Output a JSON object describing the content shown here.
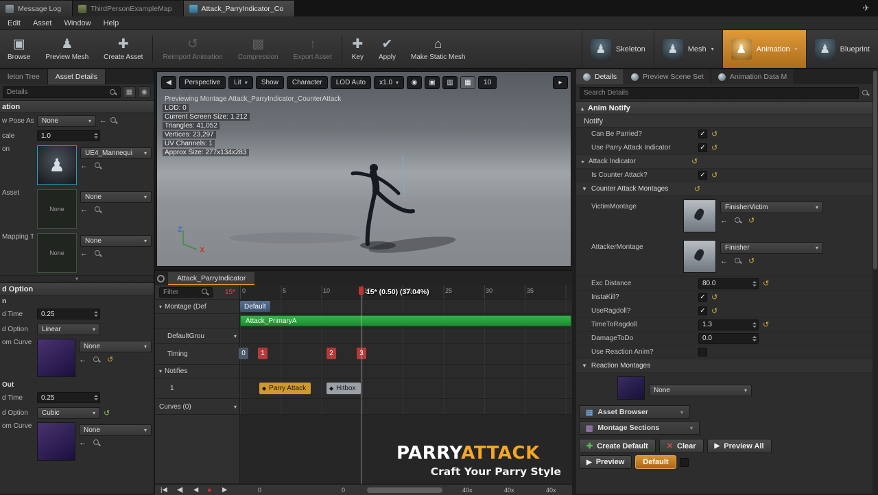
{
  "icons": {
    "dropdown": "▾",
    "caret_down": "▼",
    "caret_up": "▲",
    "tri_up": "▴",
    "tri_right": "▸",
    "back": "◀",
    "check": "✓",
    "reset": "↺",
    "pick": "←",
    "play": "▶",
    "record": "●",
    "close": "✕",
    "plus": "✚",
    "apply": "✔",
    "reimport": "↺",
    "export": "↑",
    "home": "⌂",
    "box": "▣",
    "figure": "♟",
    "grid": "▦",
    "grid2": "▥",
    "grid3": "▩",
    "lens": "◉",
    "list": "▤",
    "send": "✈",
    "skip_start": "|◀",
    "step_back": "◀|",
    "diamond": "◆",
    "eye": "◉",
    "dots": "▾"
  },
  "titlebar": {
    "tabs": [
      {
        "label": "Message Log"
      },
      {
        "label": "ThirdPersonExampleMap"
      },
      {
        "label": "Attack_ParryIndicator_Co"
      }
    ]
  },
  "menubar": {
    "items": [
      {
        "label": "Edit"
      },
      {
        "label": "Asset"
      },
      {
        "label": "Window"
      },
      {
        "label": "Help"
      }
    ]
  },
  "toolbar": {
    "actions": [
      {
        "label": "Browse"
      },
      {
        "label": "Preview Mesh"
      },
      {
        "label": "Create Asset"
      },
      {
        "label": "Reimport Animation"
      },
      {
        "label": "Compression"
      },
      {
        "label": "Export Asset"
      },
      {
        "label": "Key"
      },
      {
        "label": "Apply"
      },
      {
        "label": "Make Static Mesh"
      }
    ],
    "modes": [
      {
        "label": "Skeleton"
      },
      {
        "label": "Mesh"
      },
      {
        "label": "Animation"
      },
      {
        "label": "Blueprint"
      }
    ]
  },
  "left_panel": {
    "tab_skeleton_tree": "leton Tree",
    "tab_asset_details": "Asset Details",
    "search_placeholder": "Details",
    "section_animation": "ation",
    "preview_pose": {
      "label": "w Pose As",
      "value": "None"
    },
    "scale": {
      "label": "cale",
      "value": "1.0"
    },
    "skeleton": {
      "label": "on",
      "value": "UE4_Mannequi"
    },
    "preview_asset": {
      "label": "Asset",
      "value": "None",
      "thumb": "None"
    },
    "mapping": {
      "label": "Mapping T",
      "value": "None",
      "thumb": "None"
    },
    "section_blend": "d Option",
    "blend_in": {
      "header": "n",
      "time_label": "d Time",
      "time_value": "0.25",
      "option_label": "d Option",
      "option_value": "Linear",
      "curve_label": "om Curve",
      "curve_value": "None"
    },
    "blend_out": {
      "header": "Out",
      "time_label": "d Time",
      "time_value": "0.25",
      "option_label": "d Option",
      "option_value": "Cubic",
      "curve_label": "om Curve",
      "curve_value": "None"
    }
  },
  "viewport": {
    "toolbar": {
      "perspective": "Perspective",
      "lit": "Lit",
      "show": "Show",
      "character": "Character",
      "lod": "LOD Auto",
      "speed": "x1.0",
      "grid_size": "10"
    },
    "overlay": {
      "previewing": "Previewing Montage Attack_ParryIndicator_CounterAttack",
      "lod": "LOD: 0",
      "screen_size": "Current Screen Size: 1.212",
      "triangles": "Triangles: 41,052",
      "vertices": "Vertices: 23,297",
      "uv_channels": "UV Channels: 1",
      "approx_size": "Approx Size: 277x134x283"
    },
    "axis": {
      "z": "Z",
      "x": "X"
    }
  },
  "timeline": {
    "tab": "Attack_ParryIndicator",
    "filter_placeholder": "Filter",
    "current_frame": "15*",
    "playhead_label": "15* (0.50) (37.04%)",
    "ruler": [
      {
        "t": "0"
      },
      {
        "t": "5"
      },
      {
        "t": "10"
      },
      {
        "t": "15"
      },
      {
        "t": "20"
      },
      {
        "t": "25"
      },
      {
        "t": "30"
      },
      {
        "t": "35"
      }
    ],
    "tracks": {
      "montage_header": "Montage (Def",
      "section_chip": "Default",
      "segment": "Attack_PrimaryA",
      "default_group": "DefaultGrou",
      "timing": "Timing",
      "timing_markers": [
        {
          "label": "0"
        },
        {
          "label": "1"
        },
        {
          "label": "2"
        },
        {
          "label": "3"
        }
      ],
      "notifies_header": "Notifies",
      "notify_track": "1",
      "notifies": [
        {
          "label": "Parry Attack"
        },
        {
          "label": "Hitbox"
        }
      ],
      "curves": "Curves (0)"
    },
    "watermark": {
      "title_a": "PARRY",
      "title_b": "ATTACK",
      "subtitle": "Craft Your Parry Style"
    },
    "transport": {
      "readouts": [
        {
          "v": "0"
        },
        {
          "v": "0"
        },
        {
          "v": "40x"
        },
        {
          "v": "40x"
        },
        {
          "v": "40x"
        }
      ]
    }
  },
  "details": {
    "tabs": {
      "details": "Details",
      "preview_scene": "Preview Scene Set",
      "anim_data": "Animation Data M"
    },
    "search_placeholder": "Search Details",
    "section": "Anim Notify",
    "category": "Notify",
    "can_be_parried": "Can Be Parried?",
    "use_parry_indicator": "Use Parry Attack Indicator",
    "attack_indicator": "Attack Indicator",
    "is_counter_attack": "Is Counter Attack?",
    "counter_attack_montages": "Counter Attack Montages",
    "victim_montage": "VictimMontage",
    "victim_montage_value": "FinisherVictim",
    "attacker_montage": "AttackerMontage",
    "attacker_montage_value": "Finisher",
    "exc_distance": "Exc Distance",
    "exc_distance_value": "80.0",
    "instakill": "InstaKill?",
    "useragdoll": "UseRagdoll?",
    "time_to_ragdoll": "TimeToRagdoll",
    "time_to_ragdoll_value": "1.3",
    "damage_to_do": "DamageToDo",
    "damage_to_do_value": "0.0",
    "use_reaction_anim": "Use Reaction Anim?",
    "reaction_montages": "Reaction Montages",
    "reaction_montage_value": "None"
  },
  "bottom_right": {
    "tab_asset_browser": "Asset Browser",
    "tab_montage_sections": "Montage Sections",
    "create_default": "Create Default",
    "clear": "Clear",
    "preview_all": "Preview All",
    "preview": "Preview",
    "default": "Default"
  }
}
